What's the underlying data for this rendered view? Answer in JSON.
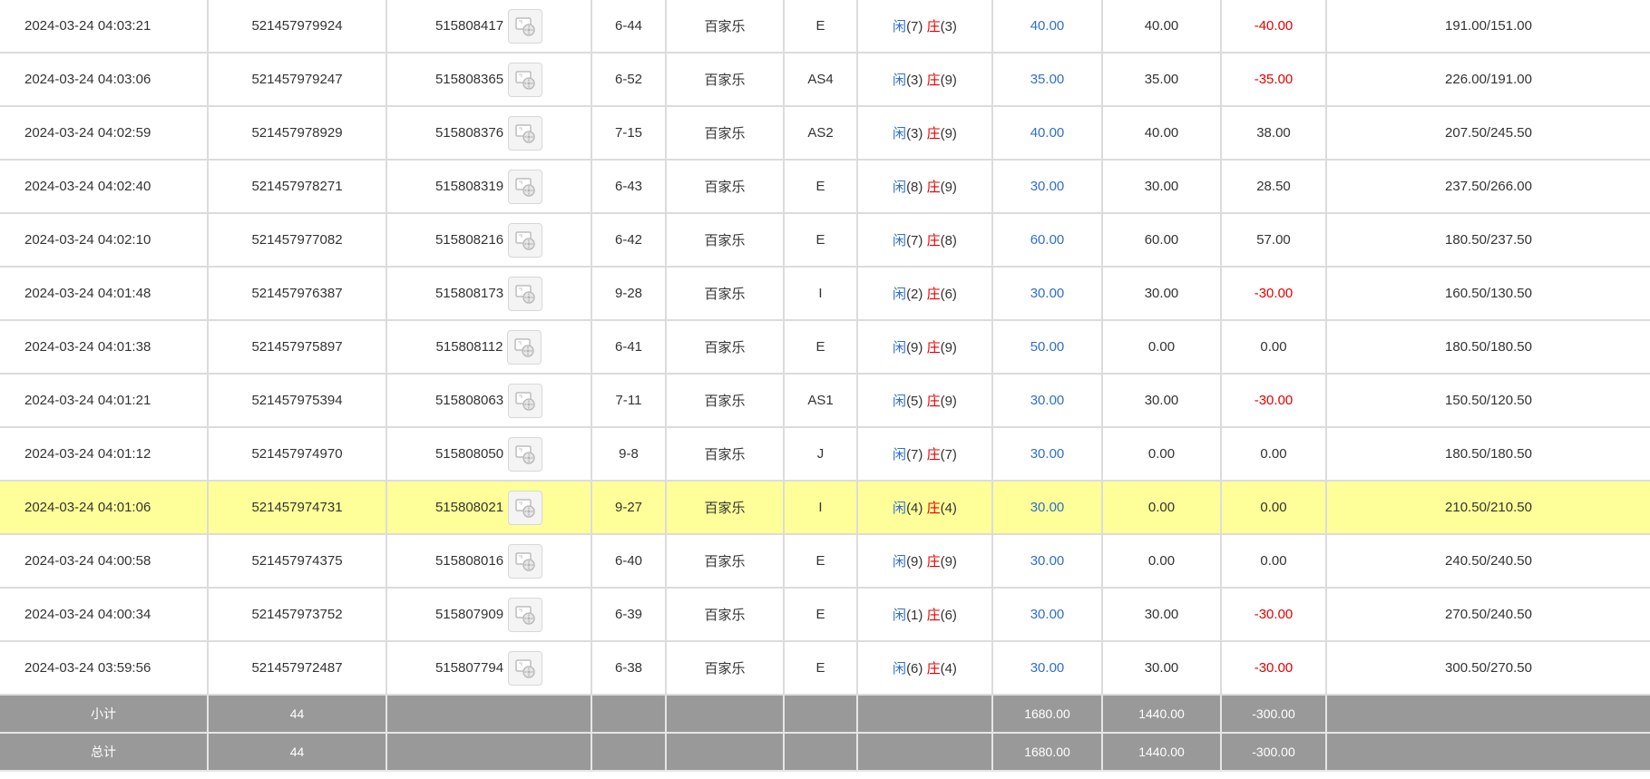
{
  "rows": [
    {
      "time": "2024-03-24 04:03:21",
      "bet_id": "521457979924",
      "round_id": "515808417",
      "table": "6-44",
      "game": "百家乐",
      "bet_type": "E",
      "player_label": "闲",
      "player_val": "(7)",
      "banker_label": "庄",
      "banker_val": "(3)",
      "bet": "40.00",
      "valid": "40.00",
      "win": "-40.00",
      "win_neg": true,
      "balance": "191.00/151.00",
      "highlight": false
    },
    {
      "time": "2024-03-24 04:03:06",
      "bet_id": "521457979247",
      "round_id": "515808365",
      "table": "6-52",
      "game": "百家乐",
      "bet_type": "AS4",
      "player_label": "闲",
      "player_val": "(3)",
      "banker_label": "庄",
      "banker_val": "(9)",
      "bet": "35.00",
      "valid": "35.00",
      "win": "-35.00",
      "win_neg": true,
      "balance": "226.00/191.00",
      "highlight": false
    },
    {
      "time": "2024-03-24 04:02:59",
      "bet_id": "521457978929",
      "round_id": "515808376",
      "table": "7-15",
      "game": "百家乐",
      "bet_type": "AS2",
      "player_label": "闲",
      "player_val": "(3)",
      "banker_label": "庄",
      "banker_val": "(9)",
      "bet": "40.00",
      "valid": "40.00",
      "win": "38.00",
      "win_neg": false,
      "balance": "207.50/245.50",
      "highlight": false
    },
    {
      "time": "2024-03-24 04:02:40",
      "bet_id": "521457978271",
      "round_id": "515808319",
      "table": "6-43",
      "game": "百家乐",
      "bet_type": "E",
      "player_label": "闲",
      "player_val": "(8)",
      "banker_label": "庄",
      "banker_val": "(9)",
      "bet": "30.00",
      "valid": "30.00",
      "win": "28.50",
      "win_neg": false,
      "balance": "237.50/266.00",
      "highlight": false
    },
    {
      "time": "2024-03-24 04:02:10",
      "bet_id": "521457977082",
      "round_id": "515808216",
      "table": "6-42",
      "game": "百家乐",
      "bet_type": "E",
      "player_label": "闲",
      "player_val": "(7)",
      "banker_label": "庄",
      "banker_val": "(8)",
      "bet": "60.00",
      "valid": "60.00",
      "win": "57.00",
      "win_neg": false,
      "balance": "180.50/237.50",
      "highlight": false
    },
    {
      "time": "2024-03-24 04:01:48",
      "bet_id": "521457976387",
      "round_id": "515808173",
      "table": "9-28",
      "game": "百家乐",
      "bet_type": "I",
      "player_label": "闲",
      "player_val": "(2)",
      "banker_label": "庄",
      "banker_val": "(6)",
      "bet": "30.00",
      "valid": "30.00",
      "win": "-30.00",
      "win_neg": true,
      "balance": "160.50/130.50",
      "highlight": false
    },
    {
      "time": "2024-03-24 04:01:38",
      "bet_id": "521457975897",
      "round_id": "515808112",
      "table": "6-41",
      "game": "百家乐",
      "bet_type": "E",
      "player_label": "闲",
      "player_val": "(9)",
      "banker_label": "庄",
      "banker_val": "(9)",
      "bet": "50.00",
      "valid": "0.00",
      "win": "0.00",
      "win_neg": false,
      "balance": "180.50/180.50",
      "highlight": false
    },
    {
      "time": "2024-03-24 04:01:21",
      "bet_id": "521457975394",
      "round_id": "515808063",
      "table": "7-11",
      "game": "百家乐",
      "bet_type": "AS1",
      "player_label": "闲",
      "player_val": "(5)",
      "banker_label": "庄",
      "banker_val": "(9)",
      "bet": "30.00",
      "valid": "30.00",
      "win": "-30.00",
      "win_neg": true,
      "balance": "150.50/120.50",
      "highlight": false
    },
    {
      "time": "2024-03-24 04:01:12",
      "bet_id": "521457974970",
      "round_id": "515808050",
      "table": "9-8",
      "game": "百家乐",
      "bet_type": "J",
      "player_label": "闲",
      "player_val": "(7)",
      "banker_label": "庄",
      "banker_val": "(7)",
      "bet": "30.00",
      "valid": "0.00",
      "win": "0.00",
      "win_neg": false,
      "balance": "180.50/180.50",
      "highlight": false
    },
    {
      "time": "2024-03-24 04:01:06",
      "bet_id": "521457974731",
      "round_id": "515808021",
      "table": "9-27",
      "game": "百家乐",
      "bet_type": "I",
      "player_label": "闲",
      "player_val": "(4)",
      "banker_label": "庄",
      "banker_val": "(4)",
      "bet": "30.00",
      "valid": "0.00",
      "win": "0.00",
      "win_neg": false,
      "balance": "210.50/210.50",
      "highlight": true
    },
    {
      "time": "2024-03-24 04:00:58",
      "bet_id": "521457974375",
      "round_id": "515808016",
      "table": "6-40",
      "game": "百家乐",
      "bet_type": "E",
      "player_label": "闲",
      "player_val": "(9)",
      "banker_label": "庄",
      "banker_val": "(9)",
      "bet": "30.00",
      "valid": "0.00",
      "win": "0.00",
      "win_neg": false,
      "balance": "240.50/240.50",
      "highlight": false
    },
    {
      "time": "2024-03-24 04:00:34",
      "bet_id": "521457973752",
      "round_id": "515807909",
      "table": "6-39",
      "game": "百家乐",
      "bet_type": "E",
      "player_label": "闲",
      "player_val": "(1)",
      "banker_label": "庄",
      "banker_val": "(6)",
      "bet": "30.00",
      "valid": "30.00",
      "win": "-30.00",
      "win_neg": true,
      "balance": "270.50/240.50",
      "highlight": false
    },
    {
      "time": "2024-03-24 03:59:56",
      "bet_id": "521457972487",
      "round_id": "515807794",
      "table": "6-38",
      "game": "百家乐",
      "bet_type": "E",
      "player_label": "闲",
      "player_val": "(6)",
      "banker_label": "庄",
      "banker_val": "(4)",
      "bet": "30.00",
      "valid": "30.00",
      "win": "-30.00",
      "win_neg": true,
      "balance": "300.50/270.50",
      "highlight": false
    }
  ],
  "subtotal": {
    "label": "小计",
    "count": "44",
    "bet": "1680.00",
    "valid": "1440.00",
    "win": "-300.00"
  },
  "total": {
    "label": "总计",
    "count": "44",
    "bet": "1680.00",
    "valid": "1440.00",
    "win": "-300.00"
  },
  "colors": {
    "blue": "#2f6fcc",
    "red": "#e60000",
    "highlight": "#ffff99",
    "summary_bg": "#999999"
  },
  "icons": {
    "replay": "video-replay-icon"
  }
}
